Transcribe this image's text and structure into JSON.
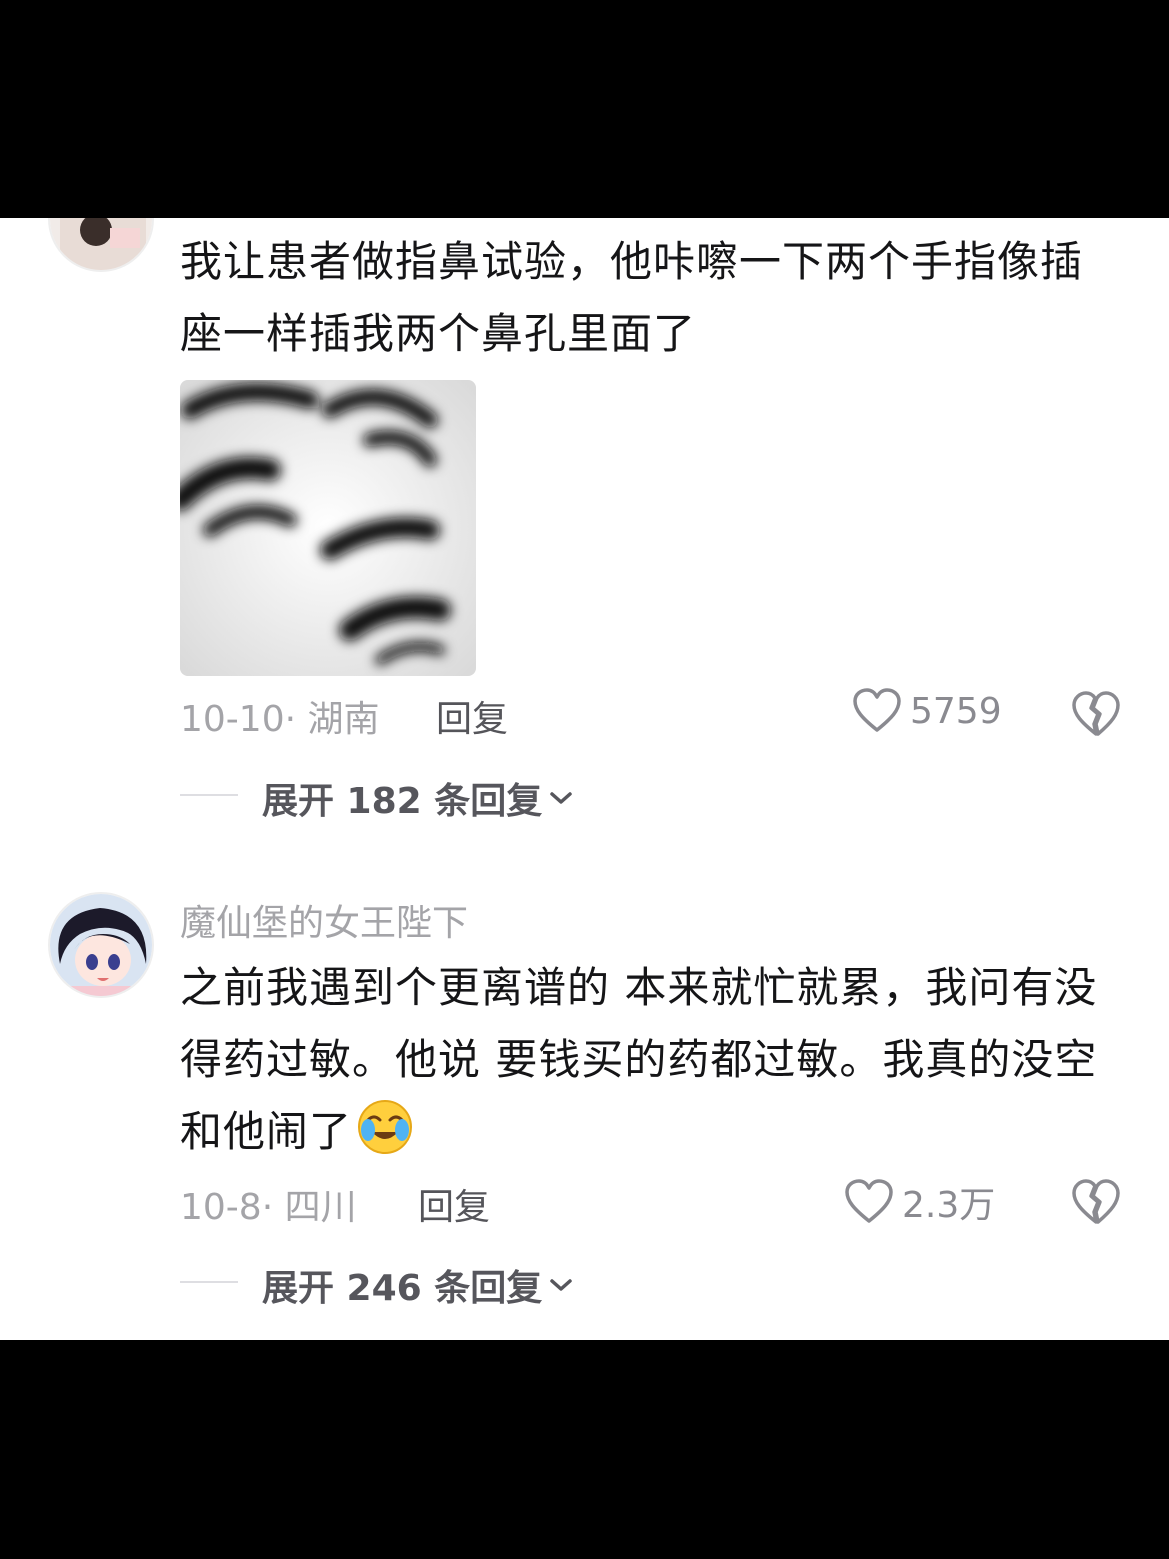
{
  "comments": [
    {
      "username": "",
      "text": "我让患者做指鼻试验，他咔嚓一下两个手指像插座一样插我两个鼻孔里面了",
      "date_location": "10-10· 湖南",
      "reply_label": "回复",
      "likes": "5759",
      "expand_label": "展开 182 条回复"
    },
    {
      "username": "魔仙堡的女王陛下",
      "text": "之前我遇到个更离谱的 本来就忙就累，我问有没得药过敏。他说 要钱买的药都过敏。我真的没空和他闹了",
      "date_location": "10-8· 四川",
      "reply_label": "回复",
      "likes": "2.3万",
      "expand_label": "展开 246 条回复"
    }
  ],
  "icons": {
    "like": "heart-outline-icon",
    "dislike": "broken-heart-icon",
    "expand": "chevron-down-icon",
    "emoji": "crying-laughing-emoji-icon"
  },
  "colors": {
    "text": "#151517",
    "meta": "#a4a4a8",
    "icon": "#8a8a90"
  }
}
